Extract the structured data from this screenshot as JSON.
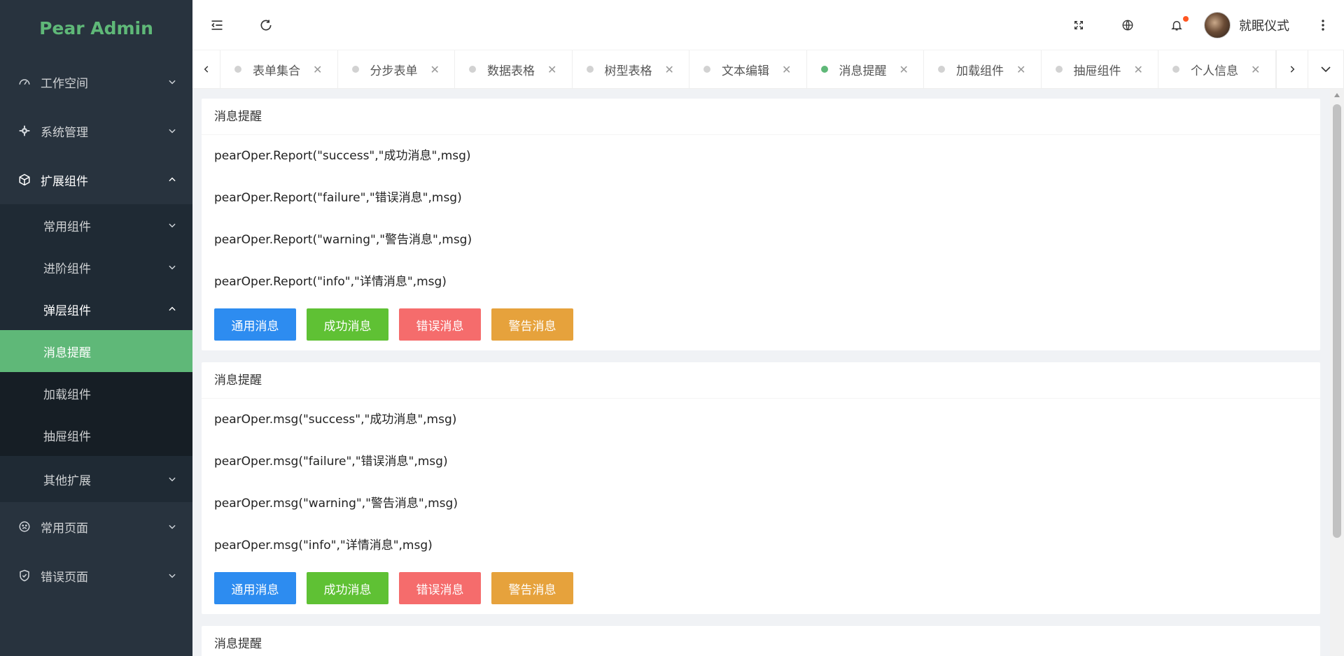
{
  "app": {
    "logo": "Pear Admin"
  },
  "sidebar": {
    "items": [
      {
        "label": "工作空间",
        "icon": "dashboard-icon"
      },
      {
        "label": "系统管理",
        "icon": "gear-icon"
      },
      {
        "label": "扩展组件",
        "icon": "cube-icon",
        "expanded": true
      },
      {
        "label": "常用页面",
        "icon": "frown-icon"
      },
      {
        "label": "错误页面",
        "icon": "shield-check-icon"
      }
    ],
    "extend_sub": [
      {
        "label": "常用组件"
      },
      {
        "label": "进阶组件"
      },
      {
        "label": "弹层组件",
        "expanded": true
      },
      {
        "label": "其他扩展"
      }
    ],
    "layer_sub": [
      {
        "label": "消息提醒",
        "selected": true
      },
      {
        "label": "加载组件"
      },
      {
        "label": "抽屉组件"
      }
    ]
  },
  "header": {
    "username": "就眠仪式",
    "notification_dot_color": "#ff5722"
  },
  "tabs": [
    {
      "label": "表单集合"
    },
    {
      "label": "分步表单"
    },
    {
      "label": "数据表格"
    },
    {
      "label": "树型表格"
    },
    {
      "label": "文本编辑"
    },
    {
      "label": "消息提醒",
      "active": true
    },
    {
      "label": "加载组件"
    },
    {
      "label": "抽屉组件"
    },
    {
      "label": "个人信息"
    }
  ],
  "cards": [
    {
      "title": "消息提醒",
      "lines": [
        "pearOper.Report(\"success\",\"成功消息\",msg)",
        "pearOper.Report(\"failure\",\"错误消息\",msg)",
        "pearOper.Report(\"warning\",\"警告消息\",msg)",
        "pearOper.Report(\"info\",\"详情消息\",msg)"
      ],
      "buttons": [
        "通用消息",
        "成功消息",
        "错误消息",
        "警告消息"
      ]
    },
    {
      "title": "消息提醒",
      "lines": [
        "pearOper.msg(\"success\",\"成功消息\",msg)",
        "pearOper.msg(\"failure\",\"错误消息\",msg)",
        "pearOper.msg(\"warning\",\"警告消息\",msg)",
        "pearOper.msg(\"info\",\"详情消息\",msg)"
      ],
      "buttons": [
        "通用消息",
        "成功消息",
        "错误消息",
        "警告消息"
      ]
    },
    {
      "title": "消息提醒"
    }
  ],
  "colors": {
    "sidebar_bg": "#28333e",
    "accent_green": "#5fb878",
    "btn_normal": "#2d8cf0",
    "btn_success": "#5fc134",
    "btn_error": "#f56c6c",
    "btn_warning": "#e6a23c"
  }
}
